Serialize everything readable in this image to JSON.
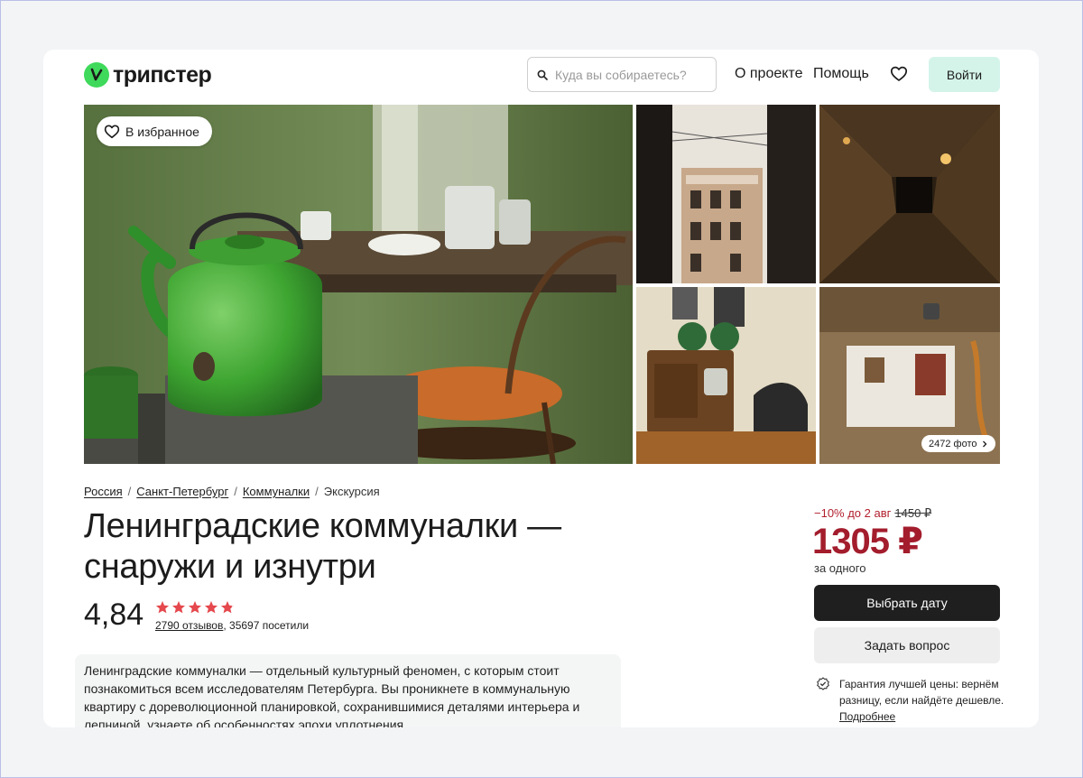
{
  "header": {
    "logo_text": "трипстер",
    "search_placeholder": "Куда вы собираетесь?",
    "nav": {
      "about": "О проекте",
      "help": "Помощь"
    },
    "login": "Войти"
  },
  "gallery": {
    "favorite_label": "В избранное",
    "photo_count": "2472 фото"
  },
  "breadcrumb": [
    "Россия",
    "Санкт-Петербург",
    "Коммуналки",
    "Экскурсия"
  ],
  "tour": {
    "title_line1": "Ленинградские коммуналки —",
    "title_line2": "снаружи и изнутри",
    "rating": "4,84",
    "stars": 4.8,
    "reviews_link": "2790 отзывов",
    "visitors": ", 35697 посетили",
    "description": "Ленинградские коммуналки — отдельный культурный феномен, с которым стоит познакомиться всем исследователям Петербурга. Вы проникнете в коммунальную квартиру с дореволюционной планировкой, сохранившимися деталями интерьера и лепниной, узнаете об особенностях эпохи уплотнения."
  },
  "pricing": {
    "discount": "−10% до 2 авг",
    "old_price": "1450 ₽",
    "price": "1305 ₽",
    "per": "за одного",
    "choose_date": "Выбрать дату",
    "ask_question": "Задать вопрос",
    "guarantee_text": "Гарантия лучшей цены: вернём разницу, если найдёте дешевле.",
    "guarantee_link": "Подробнее"
  },
  "colors": {
    "brand_green": "#3fd95b",
    "price_red": "#a31d2d",
    "star_red": "#e5484d",
    "login_bg": "#d4f4ea"
  }
}
